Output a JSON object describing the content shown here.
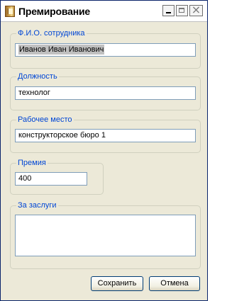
{
  "window": {
    "title": "Премирование",
    "controls": {
      "minimize_icon": "minimize-icon",
      "maximize_icon": "maximize-icon",
      "close_icon": "close-icon"
    }
  },
  "employee": {
    "label": "Ф.И.О. сотрудника",
    "value": "Иванов Иван Иванович"
  },
  "position": {
    "label": "Должность",
    "value": "технолог"
  },
  "workplace": {
    "label": "Рабочее место",
    "value": "конструкторское бюро 1"
  },
  "bonus": {
    "label": "Премия",
    "value": "400"
  },
  "merits": {
    "label": "За заслуги",
    "value": ""
  },
  "actions": {
    "save_label": "Сохранить",
    "cancel_label": "Отмена"
  },
  "colors": {
    "window_background": "#ece9d8",
    "legend_text": "#0046d5",
    "input_border": "#7f9db9",
    "selection_background": "#c0c0c0"
  }
}
